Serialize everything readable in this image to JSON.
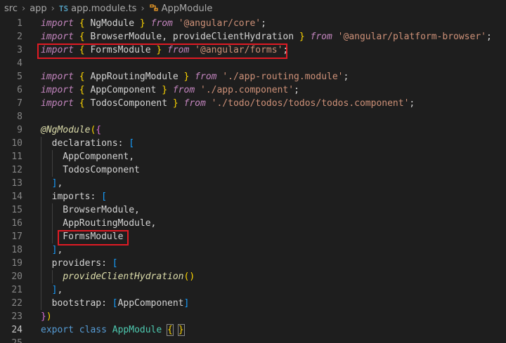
{
  "breadcrumb": {
    "src": "src",
    "app": "app",
    "file_icon": "TS",
    "file": "app.module.ts",
    "symbol_icon": "symbol-class-icon",
    "symbol": "AppModule",
    "separator": ">"
  },
  "lines": [
    {
      "n": "1",
      "tokens": [
        [
          "kw",
          "import"
        ],
        [
          "id",
          " "
        ],
        [
          "b1",
          "{"
        ],
        [
          "id",
          " NgModule "
        ],
        [
          "b1",
          "}"
        ],
        [
          "id",
          " "
        ],
        [
          "kw",
          "from"
        ],
        [
          "id",
          " "
        ],
        [
          "str",
          "'@angular/core'"
        ],
        [
          "id",
          ";"
        ]
      ]
    },
    {
      "n": "2",
      "tokens": [
        [
          "kw",
          "import"
        ],
        [
          "id",
          " "
        ],
        [
          "b1",
          "{"
        ],
        [
          "id",
          " BrowserModule, provideClientHydration "
        ],
        [
          "b1",
          "}"
        ],
        [
          "id",
          " "
        ],
        [
          "kw",
          "from"
        ],
        [
          "id",
          " "
        ],
        [
          "str",
          "'@angular/platform-browser'"
        ],
        [
          "id",
          ";"
        ]
      ]
    },
    {
      "n": "3",
      "tokens": [
        [
          "kw",
          "import"
        ],
        [
          "id",
          " "
        ],
        [
          "b1",
          "{"
        ],
        [
          "id",
          " FormsModule "
        ],
        [
          "b1",
          "}"
        ],
        [
          "id",
          " "
        ],
        [
          "kw",
          "from"
        ],
        [
          "id",
          " "
        ],
        [
          "str",
          "'@angular/forms'"
        ],
        [
          "id",
          ";"
        ]
      ]
    },
    {
      "n": "4",
      "tokens": []
    },
    {
      "n": "5",
      "tokens": [
        [
          "kw",
          "import"
        ],
        [
          "id",
          " "
        ],
        [
          "b1",
          "{"
        ],
        [
          "id",
          " AppRoutingModule "
        ],
        [
          "b1",
          "}"
        ],
        [
          "id",
          " "
        ],
        [
          "kw",
          "from"
        ],
        [
          "id",
          " "
        ],
        [
          "str",
          "'./app-routing.module'"
        ],
        [
          "id",
          ";"
        ]
      ]
    },
    {
      "n": "6",
      "tokens": [
        [
          "kw",
          "import"
        ],
        [
          "id",
          " "
        ],
        [
          "b1",
          "{"
        ],
        [
          "id",
          " AppComponent "
        ],
        [
          "b1",
          "}"
        ],
        [
          "id",
          " "
        ],
        [
          "kw",
          "from"
        ],
        [
          "id",
          " "
        ],
        [
          "str",
          "'./app.component'"
        ],
        [
          "id",
          ";"
        ]
      ]
    },
    {
      "n": "7",
      "tokens": [
        [
          "kw",
          "import"
        ],
        [
          "id",
          " "
        ],
        [
          "b1",
          "{"
        ],
        [
          "id",
          " TodosComponent "
        ],
        [
          "b1",
          "}"
        ],
        [
          "id",
          " "
        ],
        [
          "kw",
          "from"
        ],
        [
          "id",
          " "
        ],
        [
          "str",
          "'./todo/todos/todos/todos.component'"
        ],
        [
          "id",
          ";"
        ]
      ]
    },
    {
      "n": "8",
      "tokens": []
    },
    {
      "n": "9",
      "tokens": [
        [
          "fn",
          "@NgModule"
        ],
        [
          "b1",
          "("
        ],
        [
          "b2",
          "{"
        ]
      ]
    },
    {
      "n": "10",
      "tokens": [
        [
          "id",
          "  declarations: "
        ],
        [
          "b3",
          "["
        ]
      ]
    },
    {
      "n": "11",
      "tokens": [
        [
          "id",
          "    AppComponent,"
        ]
      ]
    },
    {
      "n": "12",
      "tokens": [
        [
          "id",
          "    TodosComponent"
        ]
      ]
    },
    {
      "n": "13",
      "tokens": [
        [
          "id",
          "  "
        ],
        [
          "b3",
          "]"
        ],
        [
          "id",
          ","
        ]
      ]
    },
    {
      "n": "14",
      "tokens": [
        [
          "id",
          "  imports: "
        ],
        [
          "b3",
          "["
        ]
      ]
    },
    {
      "n": "15",
      "tokens": [
        [
          "id",
          "    BrowserModule,"
        ]
      ]
    },
    {
      "n": "16",
      "tokens": [
        [
          "id",
          "    AppRoutingModule,"
        ]
      ]
    },
    {
      "n": "17",
      "tokens": [
        [
          "id",
          "    FormsModule"
        ]
      ]
    },
    {
      "n": "18",
      "tokens": [
        [
          "id",
          "  "
        ],
        [
          "b3",
          "]"
        ],
        [
          "id",
          ","
        ]
      ]
    },
    {
      "n": "19",
      "tokens": [
        [
          "id",
          "  providers: "
        ],
        [
          "b3",
          "["
        ]
      ]
    },
    {
      "n": "20",
      "tokens": [
        [
          "id",
          "    "
        ],
        [
          "fn",
          "provideClientHydration"
        ],
        [
          "b1",
          "()"
        ]
      ]
    },
    {
      "n": "21",
      "tokens": [
        [
          "id",
          "  "
        ],
        [
          "b3",
          "]"
        ],
        [
          "id",
          ","
        ]
      ]
    },
    {
      "n": "22",
      "tokens": [
        [
          "id",
          "  bootstrap: "
        ],
        [
          "b3",
          "["
        ],
        [
          "id",
          "AppComponent"
        ],
        [
          "b3",
          "]"
        ]
      ]
    },
    {
      "n": "23",
      "tokens": [
        [
          "b2",
          "}"
        ],
        [
          "b1",
          ")"
        ]
      ]
    },
    {
      "n": "24",
      "tokens": [
        [
          "bl",
          "export"
        ],
        [
          "id",
          " "
        ],
        [
          "bl",
          "class"
        ],
        [
          "id",
          " "
        ],
        [
          "cls",
          "AppModule"
        ],
        [
          "id",
          " "
        ],
        [
          "b1m",
          "{"
        ],
        [
          "id",
          " "
        ],
        [
          "b1m",
          "}"
        ]
      ]
    },
    {
      "n": "25",
      "tokens": []
    }
  ],
  "current_line": "24",
  "colors": {
    "background": "#1e1e1e",
    "highlight_box": "#e01b24",
    "keyword": "#c586c0",
    "string": "#ce9178",
    "bracket_gold": "#ffd700",
    "bracket_purple": "#da70d6",
    "bracket_blue": "#179fff"
  }
}
